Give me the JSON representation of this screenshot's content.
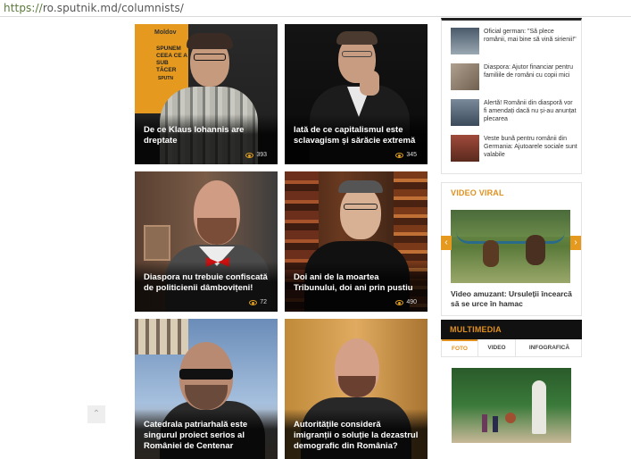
{
  "url": {
    "scheme": "https://",
    "rest": "ro.sputnik.md/columnists/"
  },
  "cards": [
    {
      "title": "De ce Klaus Iohannis are dreptate",
      "views": "393"
    },
    {
      "title": "Iată de ce capitalismul este sclavagism și sărăcie extremă",
      "views": "345"
    },
    {
      "title": "Diaspora nu trebuie confiscată de politicienii dâmbovițeni!",
      "views": "72"
    },
    {
      "title": "Doi ani de la moartea Tribunului, doi ani prin pustiu",
      "views": "490"
    },
    {
      "title": "Catedrala patriarhală este singurul proiect serios al României de Centenar",
      "views": ""
    },
    {
      "title": "Autoritățile consideră imigranții o soluție la dezastrul demografic din România?",
      "views": ""
    }
  ],
  "card1_sign": {
    "line1": "Moldov",
    "line2": "SPUNEM",
    "line3": "CEEA CE A",
    "line4": "SUB TĂCER",
    "line5": "SPUTN"
  },
  "news": [
    {
      "text": "Oficial german: \"Să plece românii, mai bine să vină sirienii!\""
    },
    {
      "text": "Diaspora: Ajutor financiar pentru familiile de români cu copii mici"
    },
    {
      "text": "Alertă! Românii din diasporă vor fi amendați dacă nu și-au anunțat plecarea"
    },
    {
      "text": "Veste bună pentru românii din Germania: Ajutoarele sociale sunt valabile"
    }
  ],
  "video": {
    "heading": "VIDEO VIRAL",
    "caption": "Video amuzant: Ursuleții încearcă să se urce în hamac",
    "prev": "‹",
    "next": "›"
  },
  "multimedia": {
    "heading": "MULTIMEDIA",
    "tabs": [
      "FOTO",
      "VIDEO",
      "INFOGRAFICĂ"
    ]
  },
  "colors": {
    "accent": "#e0901e",
    "dark": "#111111"
  },
  "icons": {
    "views": "eye-icon",
    "scroll": "chevron-up-icon"
  }
}
